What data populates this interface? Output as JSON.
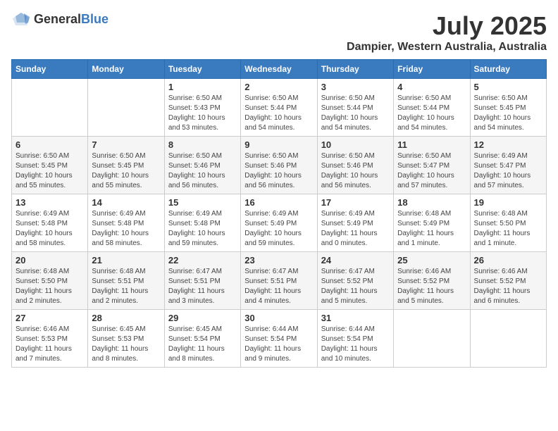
{
  "header": {
    "logo_general": "General",
    "logo_blue": "Blue",
    "month_year": "July 2025",
    "location": "Dampier, Western Australia, Australia"
  },
  "days_of_week": [
    "Sunday",
    "Monday",
    "Tuesday",
    "Wednesday",
    "Thursday",
    "Friday",
    "Saturday"
  ],
  "weeks": [
    [
      {
        "day": "",
        "detail": ""
      },
      {
        "day": "",
        "detail": ""
      },
      {
        "day": "1",
        "detail": "Sunrise: 6:50 AM\nSunset: 5:43 PM\nDaylight: 10 hours\nand 53 minutes."
      },
      {
        "day": "2",
        "detail": "Sunrise: 6:50 AM\nSunset: 5:44 PM\nDaylight: 10 hours\nand 54 minutes."
      },
      {
        "day": "3",
        "detail": "Sunrise: 6:50 AM\nSunset: 5:44 PM\nDaylight: 10 hours\nand 54 minutes."
      },
      {
        "day": "4",
        "detail": "Sunrise: 6:50 AM\nSunset: 5:44 PM\nDaylight: 10 hours\nand 54 minutes."
      },
      {
        "day": "5",
        "detail": "Sunrise: 6:50 AM\nSunset: 5:45 PM\nDaylight: 10 hours\nand 54 minutes."
      }
    ],
    [
      {
        "day": "6",
        "detail": "Sunrise: 6:50 AM\nSunset: 5:45 PM\nDaylight: 10 hours\nand 55 minutes."
      },
      {
        "day": "7",
        "detail": "Sunrise: 6:50 AM\nSunset: 5:45 PM\nDaylight: 10 hours\nand 55 minutes."
      },
      {
        "day": "8",
        "detail": "Sunrise: 6:50 AM\nSunset: 5:46 PM\nDaylight: 10 hours\nand 56 minutes."
      },
      {
        "day": "9",
        "detail": "Sunrise: 6:50 AM\nSunset: 5:46 PM\nDaylight: 10 hours\nand 56 minutes."
      },
      {
        "day": "10",
        "detail": "Sunrise: 6:50 AM\nSunset: 5:46 PM\nDaylight: 10 hours\nand 56 minutes."
      },
      {
        "day": "11",
        "detail": "Sunrise: 6:50 AM\nSunset: 5:47 PM\nDaylight: 10 hours\nand 57 minutes."
      },
      {
        "day": "12",
        "detail": "Sunrise: 6:49 AM\nSunset: 5:47 PM\nDaylight: 10 hours\nand 57 minutes."
      }
    ],
    [
      {
        "day": "13",
        "detail": "Sunrise: 6:49 AM\nSunset: 5:48 PM\nDaylight: 10 hours\nand 58 minutes."
      },
      {
        "day": "14",
        "detail": "Sunrise: 6:49 AM\nSunset: 5:48 PM\nDaylight: 10 hours\nand 58 minutes."
      },
      {
        "day": "15",
        "detail": "Sunrise: 6:49 AM\nSunset: 5:48 PM\nDaylight: 10 hours\nand 59 minutes."
      },
      {
        "day": "16",
        "detail": "Sunrise: 6:49 AM\nSunset: 5:49 PM\nDaylight: 10 hours\nand 59 minutes."
      },
      {
        "day": "17",
        "detail": "Sunrise: 6:49 AM\nSunset: 5:49 PM\nDaylight: 11 hours\nand 0 minutes."
      },
      {
        "day": "18",
        "detail": "Sunrise: 6:48 AM\nSunset: 5:49 PM\nDaylight: 11 hours\nand 1 minute."
      },
      {
        "day": "19",
        "detail": "Sunrise: 6:48 AM\nSunset: 5:50 PM\nDaylight: 11 hours\nand 1 minute."
      }
    ],
    [
      {
        "day": "20",
        "detail": "Sunrise: 6:48 AM\nSunset: 5:50 PM\nDaylight: 11 hours\nand 2 minutes."
      },
      {
        "day": "21",
        "detail": "Sunrise: 6:48 AM\nSunset: 5:51 PM\nDaylight: 11 hours\nand 2 minutes."
      },
      {
        "day": "22",
        "detail": "Sunrise: 6:47 AM\nSunset: 5:51 PM\nDaylight: 11 hours\nand 3 minutes."
      },
      {
        "day": "23",
        "detail": "Sunrise: 6:47 AM\nSunset: 5:51 PM\nDaylight: 11 hours\nand 4 minutes."
      },
      {
        "day": "24",
        "detail": "Sunrise: 6:47 AM\nSunset: 5:52 PM\nDaylight: 11 hours\nand 5 minutes."
      },
      {
        "day": "25",
        "detail": "Sunrise: 6:46 AM\nSunset: 5:52 PM\nDaylight: 11 hours\nand 5 minutes."
      },
      {
        "day": "26",
        "detail": "Sunrise: 6:46 AM\nSunset: 5:52 PM\nDaylight: 11 hours\nand 6 minutes."
      }
    ],
    [
      {
        "day": "27",
        "detail": "Sunrise: 6:46 AM\nSunset: 5:53 PM\nDaylight: 11 hours\nand 7 minutes."
      },
      {
        "day": "28",
        "detail": "Sunrise: 6:45 AM\nSunset: 5:53 PM\nDaylight: 11 hours\nand 8 minutes."
      },
      {
        "day": "29",
        "detail": "Sunrise: 6:45 AM\nSunset: 5:54 PM\nDaylight: 11 hours\nand 8 minutes."
      },
      {
        "day": "30",
        "detail": "Sunrise: 6:44 AM\nSunset: 5:54 PM\nDaylight: 11 hours\nand 9 minutes."
      },
      {
        "day": "31",
        "detail": "Sunrise: 6:44 AM\nSunset: 5:54 PM\nDaylight: 11 hours\nand 10 minutes."
      },
      {
        "day": "",
        "detail": ""
      },
      {
        "day": "",
        "detail": ""
      }
    ]
  ]
}
